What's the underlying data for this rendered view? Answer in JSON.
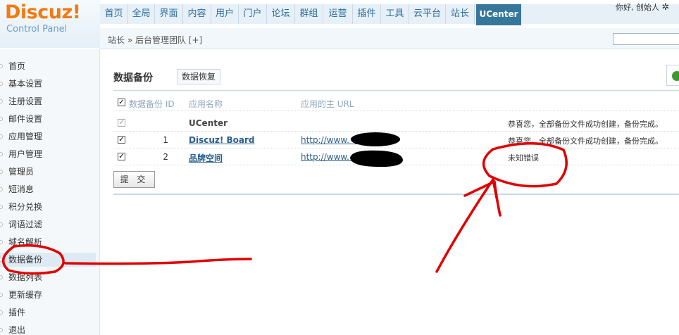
{
  "logo": {
    "main": "Discuz!",
    "sub": "Control Panel"
  },
  "nav": {
    "items": [
      "首页",
      "全局",
      "界面",
      "内容",
      "用户",
      "门户",
      "论坛",
      "群组",
      "运营",
      "插件",
      "工具",
      "云平台",
      "站长",
      "UCenter"
    ],
    "active": "UCenter"
  },
  "greeting": "你好, 创始人",
  "breadcrumb": "站长 » 后台管理团队  [+]",
  "sidebar": {
    "items": [
      "首页",
      "基本设置",
      "注册设置",
      "邮件设置",
      "应用管理",
      "用户管理",
      "管理员",
      "短消息",
      "积分兑换",
      "词语过滤",
      "域名解析",
      "数据备份",
      "数据列表",
      "更新缓存",
      "插件",
      "退出"
    ],
    "active": "数据备份"
  },
  "main": {
    "title": "数据备份",
    "restore_label": "数据恢复",
    "table": {
      "headers": {
        "id": "数据备份 ID",
        "name": "应用名称",
        "url": "应用的主 URL"
      },
      "rows": [
        {
          "checked": true,
          "disabled": true,
          "id": "",
          "name": "UCenter",
          "url": "",
          "status": "恭喜您，全部备份文件成功创建，备份完成。"
        },
        {
          "checked": true,
          "disabled": false,
          "id": "1",
          "name": "Discuz! Board",
          "url": "http://www.         .com",
          "status": "恭喜您，全部备份文件成功创建，备份完成。"
        },
        {
          "checked": true,
          "disabled": false,
          "id": "2",
          "name": "品牌空间",
          "url": "http://www.                      n/brand",
          "status": "未知错误"
        }
      ]
    },
    "submit_label": "提 交"
  },
  "colors": {
    "accent": "#36769b",
    "brand": "#f27a10",
    "annotation": "#e00000"
  }
}
